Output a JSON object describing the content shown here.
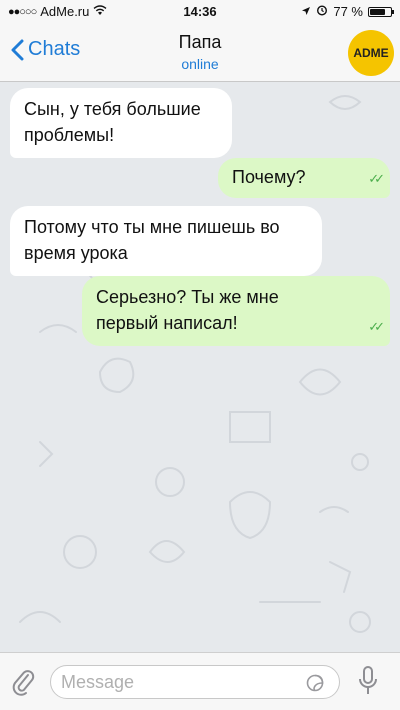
{
  "status_bar": {
    "signal": "●●○○○",
    "carrier": "AdMe.ru",
    "time": "14:36",
    "battery": "77 %",
    "battery_level": 0.77
  },
  "header": {
    "back_label": "Chats",
    "title": "Папа",
    "subtitle": "online",
    "avatar_text": "ADME"
  },
  "messages": [
    {
      "direction": "incoming",
      "text": "Сын, у тебя большие проблемы!"
    },
    {
      "direction": "outgoing",
      "text": "Почему?"
    },
    {
      "direction": "incoming",
      "text": "Потому что ты мне пишешь во время урока"
    },
    {
      "direction": "outgoing",
      "text": "Серьезно? Ты же мне первый написал!"
    }
  ],
  "composer": {
    "placeholder": "Message"
  },
  "colors": {
    "accent": "#1f7cd6",
    "outgoing_bubble": "#dcf8c6",
    "incoming_bubble": "#ffffff",
    "read_ticks": "#4cae4c",
    "avatar_bg": "#f5c400"
  }
}
